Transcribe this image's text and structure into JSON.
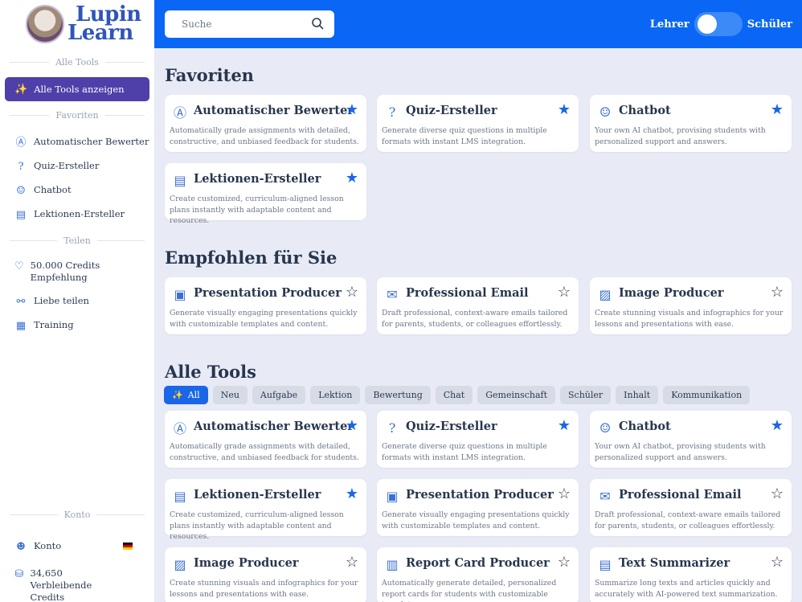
{
  "brand": {
    "line1": "Lupin",
    "line2": "Learn"
  },
  "sidebar": {
    "sections": {
      "all_tools": "Alle Tools",
      "favorites": "Favoriten",
      "share": "Teilen",
      "account": "Konto"
    },
    "show_all": "Alle Tools anzeigen",
    "favorites": [
      {
        "label": "Automatischer Bewerter",
        "icon": "a-plus-grade-icon"
      },
      {
        "label": "Quiz-Ersteller",
        "icon": "quiz-icon"
      },
      {
        "label": "Chatbot",
        "icon": "robot-icon"
      },
      {
        "label": "Lektionen-Ersteller",
        "icon": "lesson-board-icon"
      }
    ],
    "share": [
      {
        "label": "50.000 Credits Empfehlung",
        "icon": "heart-hand-icon"
      },
      {
        "label": "Liebe teilen",
        "icon": "share-icon"
      },
      {
        "label": "Training",
        "icon": "training-icon"
      }
    ],
    "account": [
      {
        "label": "Konto",
        "icon": "user-icon"
      },
      {
        "label": "34,650 Verbleibende Credits",
        "icon": "credits-icon"
      }
    ]
  },
  "topbar": {
    "search_placeholder": "Suche",
    "role_left": "Lehrer",
    "role_right": "Schüler"
  },
  "sections": {
    "favorites": "Favoriten",
    "recommended": "Empfohlen für Sie",
    "all_tools": "Alle Tools"
  },
  "filters": [
    "All",
    "Neu",
    "Aufgabe",
    "Lektion",
    "Bewertung",
    "Chat",
    "Gemeinschaft",
    "Schüler",
    "Inhalt",
    "Kommunikation"
  ],
  "tools": {
    "grader": {
      "title": "Automatischer Bewerter",
      "desc": "Automatically grade assignments with detailed, constructive, and unbiased feedback for students."
    },
    "quiz": {
      "title": "Quiz-Ersteller",
      "desc": "Generate diverse quiz questions in multiple formats with instant LMS integration."
    },
    "chatbot": {
      "title": "Chatbot",
      "desc": "Your own AI chatbot, provising students with personalized support and answers."
    },
    "lesson": {
      "title": "Lektionen-Ersteller",
      "desc": "Create customized, curriculum-aligned lesson plans instantly with adaptable content and resources."
    },
    "presentation": {
      "title": "Presentation Producer",
      "desc": "Generate visually engaging presentations quickly with customizable templates and content."
    },
    "email": {
      "title": "Professional Email",
      "desc": "Draft professional, context-aware emails tailored for parents, students, or colleagues effortlessly."
    },
    "image": {
      "title": "Image Producer",
      "desc": "Create stunning visuals and infographics for your lessons and presentations with ease."
    },
    "report": {
      "title": "Report Card Producer",
      "desc": "Automatically generate detailed, personalized report cards for students with customizable templates."
    },
    "summarizer": {
      "title": "Text Summarizer",
      "desc": "Summarize long texts and articles quickly and accurately with AI-powered text summarization."
    }
  },
  "colors": {
    "topbar": "#0a66f5",
    "active_nav": "#4f3fa8",
    "star_filled": "#1a66e8",
    "background": "#e8ebf5"
  }
}
